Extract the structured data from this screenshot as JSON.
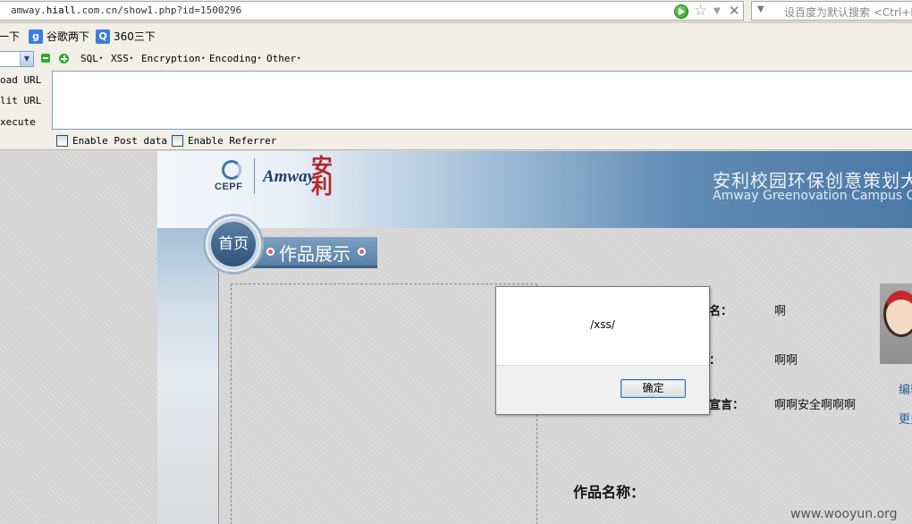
{
  "browser": {
    "url_prefix": "amway.",
    "url_host": "hiall",
    "url_rest": ".com.cn/show1.php?id=1500296",
    "search_placeholder": "设百度为默认搜索 <Ctrl+K>",
    "icons": [
      "go-icon",
      "star-icon",
      "dropdown-icon",
      "close-icon"
    ]
  },
  "bookmarks": [
    {
      "label": "一下",
      "icon": "baidu-icon"
    },
    {
      "label": "谷歌两下",
      "icon": "google-icon",
      "color": "#3b7de0",
      "glyph": "g"
    },
    {
      "label": "360三下",
      "icon": "search-360-icon",
      "color": "#3b7de0",
      "glyph": "Q"
    }
  ],
  "hackbar": {
    "menus": [
      "SQL",
      "XSS",
      "Encryption",
      "Encoding",
      "Other"
    ],
    "side_labels": [
      "oad URL",
      "lit URL",
      "xecute"
    ],
    "post_checkbox": "Enable Post data",
    "referrer_checkbox": "Enable Referrer"
  },
  "site": {
    "logo_cepf": "CEPF",
    "logo_amway": "Amway",
    "logo_an": "安利",
    "title_cn": "安利校园环保创意策划大",
    "title_en": "Amway Greenovation Campus Compet",
    "home_label": "首页",
    "section_title": "作品展示",
    "fields": [
      {
        "label": "名：",
        "value": "啊"
      },
      {
        "label": "：",
        "value": "啊啊"
      },
      {
        "label": "宣言：",
        "value": "啊啊安全啊啊啊"
      }
    ],
    "work_name_label": "作品名称：",
    "side_links": [
      "编辑",
      "更多"
    ],
    "watermark": "www.wooyun.org"
  },
  "alert": {
    "message": "/xss/",
    "ok_label": "确定"
  }
}
